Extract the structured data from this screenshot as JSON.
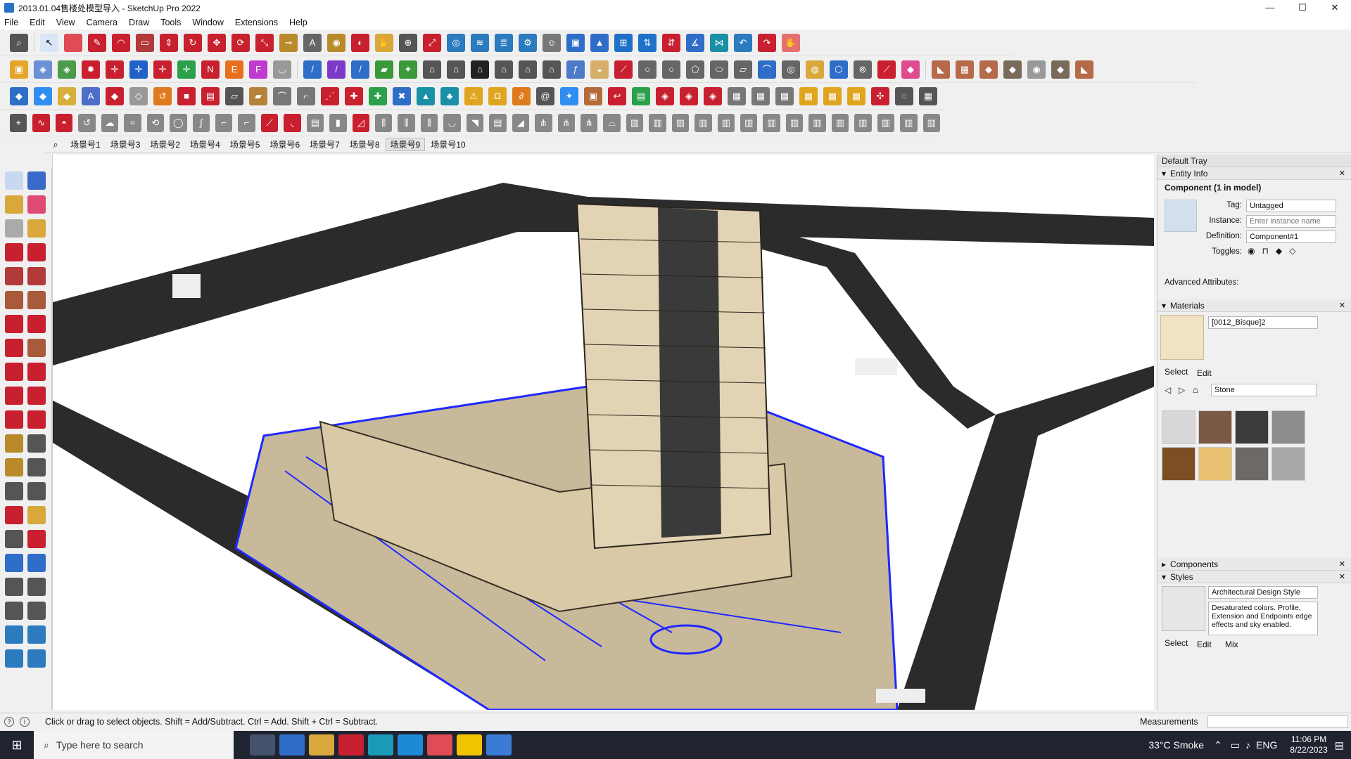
{
  "window": {
    "title": "2013.01.04售楼处模型导入 - SketchUp Pro 2022",
    "min": "—",
    "max": "☐",
    "close": "✕"
  },
  "menu": [
    "File",
    "Edit",
    "View",
    "Camera",
    "Draw",
    "Tools",
    "Window",
    "Extensions",
    "Help"
  ],
  "scenes": {
    "search_icon": "search-icon",
    "tabs": [
      "场景号1",
      "场景号3",
      "场景号2",
      "场景号4",
      "场景号5",
      "场景号6",
      "场景号7",
      "场景号8",
      "场景号9",
      "场景号10"
    ],
    "active_index": 8
  },
  "tray": {
    "title": "Default Tray",
    "entity_info": {
      "section": "Entity Info",
      "heading": "Component (1 in model)",
      "tag_label": "Tag:",
      "tag_value": "Untagged",
      "instance_label": "Instance:",
      "instance_placeholder": "Enter instance name",
      "definition_label": "Definition:",
      "definition_value": "Component#1",
      "toggles_label": "Toggles:",
      "advanced": "Advanced Attributes:"
    },
    "materials": {
      "section": "Materials",
      "current": "[0012_Bisque]2",
      "tab_select": "Select",
      "tab_edit": "Edit",
      "library": "Stone",
      "swatches": [
        "#d7d7d7",
        "#7a5a44",
        "#3b3b3b",
        "#8d8d8d",
        "#7b4e24",
        "#e7c171",
        "#6e6867",
        "#a9a9a9"
      ]
    },
    "components": {
      "section": "Components"
    },
    "styles": {
      "section": "Styles",
      "name": "Architectural Design Style",
      "description": "Desaturated colors. Profile, Extension and Endpoints edge effects and sky enabled.",
      "tab_select": "Select",
      "tab_edit": "Edit",
      "tab_mix": "Mix"
    }
  },
  "status": {
    "message": "Click or drag to select objects. Shift = Add/Subtract. Ctrl = Add. Shift + Ctrl = Subtract.",
    "measurements_label": "Measurements"
  },
  "taskbar": {
    "search_placeholder": "Type here to search",
    "weather": "33°C  Smoke",
    "lang": "ENG",
    "time": "11:06 PM",
    "date": "8/22/2023"
  },
  "colors": {
    "road": "#2b2b2b",
    "ground": "#c8b99a",
    "building": "#e2d3b4",
    "selection": "#1f28ff"
  }
}
